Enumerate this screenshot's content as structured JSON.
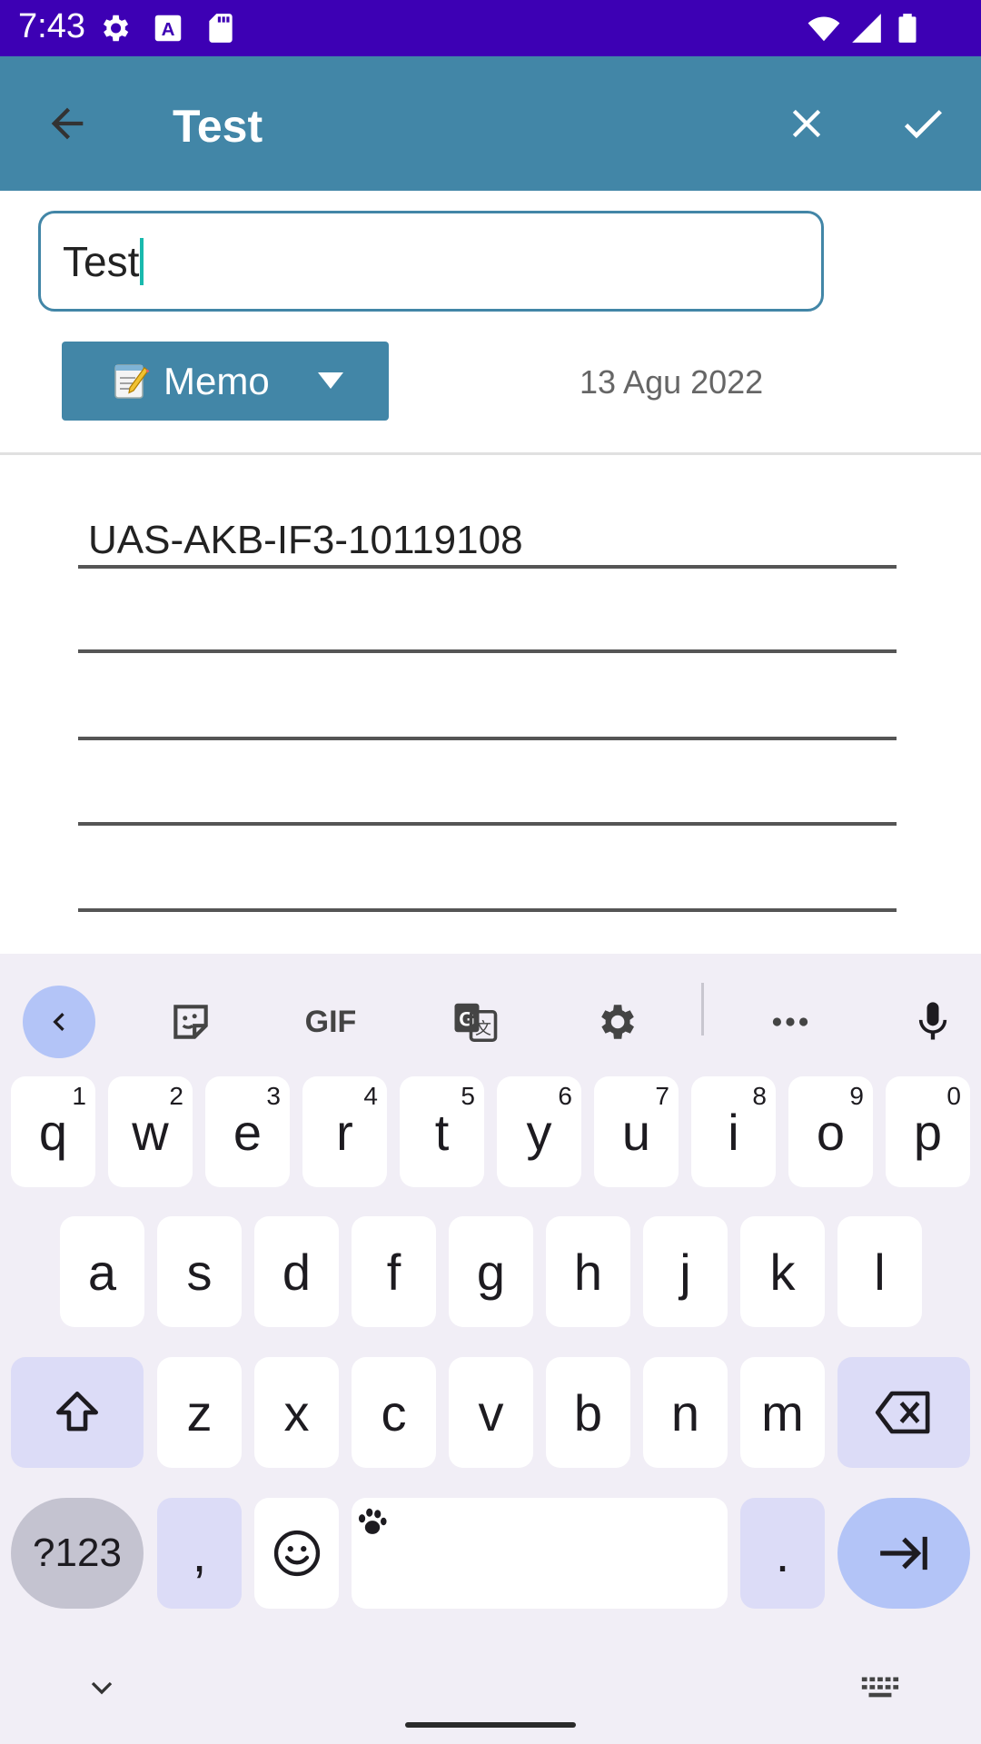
{
  "status_bar": {
    "time": "7:43",
    "icons": [
      "gear-icon",
      "a-icon",
      "sd-card-icon",
      "wifi-icon",
      "signal-icon",
      "battery-icon"
    ]
  },
  "app_bar": {
    "title": "Test",
    "back_icon": "arrow-left-icon",
    "cancel_icon": "close-icon",
    "confirm_icon": "check-icon",
    "color": "#4286a7"
  },
  "form": {
    "title_value": "Test",
    "category": {
      "emoji": "memo-icon",
      "label": "Memo"
    },
    "date": "13 Agu 2022",
    "memo_text": "UAS-AKB-IF3-10119108"
  },
  "keyboard": {
    "toolbar": [
      "chevron-left-icon",
      "sticker-icon",
      "GIF",
      "translate-icon",
      "gear-icon",
      "more-icon",
      "mic-icon"
    ],
    "row1": [
      {
        "key": "q",
        "hint": "1"
      },
      {
        "key": "w",
        "hint": "2"
      },
      {
        "key": "e",
        "hint": "3"
      },
      {
        "key": "r",
        "hint": "4"
      },
      {
        "key": "t",
        "hint": "5"
      },
      {
        "key": "y",
        "hint": "6"
      },
      {
        "key": "u",
        "hint": "7"
      },
      {
        "key": "i",
        "hint": "8"
      },
      {
        "key": "o",
        "hint": "9"
      },
      {
        "key": "p",
        "hint": "0"
      }
    ],
    "row2": [
      "a",
      "s",
      "d",
      "f",
      "g",
      "h",
      "j",
      "k",
      "l"
    ],
    "row3": [
      "z",
      "x",
      "c",
      "v",
      "b",
      "n",
      "m"
    ],
    "symbols_label": "?123",
    "comma": ",",
    "period": "."
  }
}
